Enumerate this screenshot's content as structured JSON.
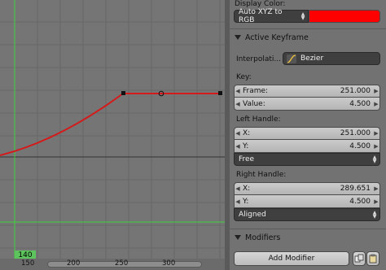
{
  "graph": {
    "current_frame": "140",
    "ticks": [
      "150",
      "200",
      "250",
      "300"
    ]
  },
  "panel": {
    "display_color_label": "Display Color:",
    "display_color_mode": "Auto XYZ to RGB",
    "display_color_value": "#ff0000",
    "active_keyframe_title": "Active Keyframe",
    "interpolation_label": "Interpolati...",
    "interpolation_value": "Bezier",
    "key_label": "Key:",
    "key_frame_label": "Frame:",
    "key_frame_value": "251.000",
    "key_value_label": "Value:",
    "key_value_value": "4.500",
    "left_handle_label": "Left Handle:",
    "left_x_label": "X:",
    "left_x_value": "251.000",
    "left_y_label": "Y:",
    "left_y_value": "4.500",
    "left_handle_type": "Free",
    "right_handle_label": "Right Handle:",
    "right_x_label": "X:",
    "right_x_value": "289.651",
    "right_y_label": "Y:",
    "right_y_value": "4.500",
    "right_handle_type": "Aligned",
    "modifiers_title": "Modifiers",
    "add_modifier_label": "Add Modifier"
  },
  "colors": {
    "curve": "#d41a1a",
    "playhead": "#3ed33e",
    "display_color": "#ff0000"
  },
  "icons": [
    "interpolation-bezier-icon",
    "copy-modifiers-icon",
    "paste-modifiers-icon"
  ]
}
